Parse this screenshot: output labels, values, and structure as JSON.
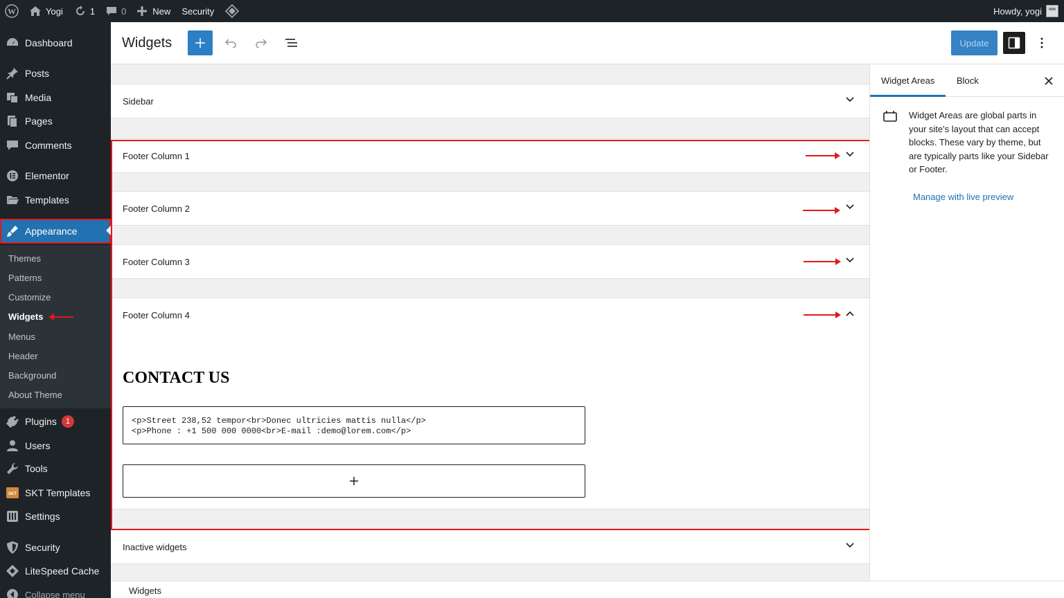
{
  "adminbar": {
    "site_name": "Yogi",
    "updates_count": "1",
    "comments_count": "0",
    "new_label": "New",
    "security_label": "Security",
    "howdy": "Howdy, yogi"
  },
  "sidebar": {
    "items": [
      {
        "label": "Dashboard",
        "icon": "dashboard-icon"
      },
      {
        "label": "Posts",
        "icon": "pin-icon"
      },
      {
        "label": "Media",
        "icon": "media-icon"
      },
      {
        "label": "Pages",
        "icon": "pages-icon"
      },
      {
        "label": "Comments",
        "icon": "comment-icon"
      },
      {
        "label": "Elementor",
        "icon": "elementor-icon"
      },
      {
        "label": "Templates",
        "icon": "folder-icon"
      },
      {
        "label": "Appearance",
        "icon": "brush-icon"
      },
      {
        "label": "Plugins",
        "icon": "plug-icon",
        "badge": "1"
      },
      {
        "label": "Users",
        "icon": "user-icon"
      },
      {
        "label": "Tools",
        "icon": "wrench-icon"
      },
      {
        "label": "SKT Templates",
        "icon": "skt-icon"
      },
      {
        "label": "Settings",
        "icon": "settings-icon"
      },
      {
        "label": "Security",
        "icon": "shield-icon"
      },
      {
        "label": "LiteSpeed Cache",
        "icon": "diamond-icon"
      },
      {
        "label": "Collapse menu",
        "icon": "collapse-icon"
      }
    ],
    "submenu": [
      "Themes",
      "Patterns",
      "Customize",
      "Widgets",
      "Menus",
      "Header",
      "Background",
      "About Theme"
    ]
  },
  "header": {
    "title": "Widgets",
    "update_label": "Update"
  },
  "areas": {
    "sidebar": "Sidebar",
    "footer1": "Footer Column 1",
    "footer2": "Footer Column 2",
    "footer3": "Footer Column 3",
    "footer4": "Footer Column 4",
    "inactive": "Inactive widgets"
  },
  "footer4_content": {
    "heading": "CONTACT US",
    "html_line1": "<p>Street 238,52 tempor<br>Donec ultricies mattis nulla</p>",
    "html_line2": "<p>Phone : +1 500 000 0000<br>E-mail :demo@lorem.com</p>"
  },
  "panel": {
    "tab_widget_areas": "Widget Areas",
    "tab_block": "Block",
    "description": "Widget Areas are global parts in your site's layout that can accept blocks. These vary by theme, but are typically parts like your Sidebar or Footer.",
    "link": "Manage with live preview"
  },
  "breadcrumb": "Widgets",
  "colors": {
    "accent": "#2271b1",
    "annotation": "#e0191b",
    "admin_dark": "#1d2327"
  }
}
